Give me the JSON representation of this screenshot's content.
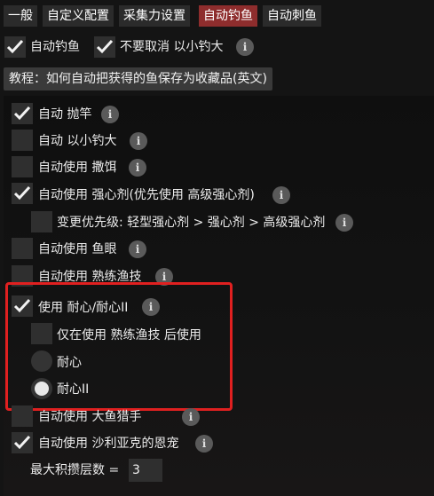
{
  "tabs": [
    {
      "label": "一般",
      "active": false
    },
    {
      "label": "自定义配置",
      "active": false
    },
    {
      "label": "采集力设置",
      "active": false
    },
    {
      "label": "自动钓鱼",
      "active": true
    },
    {
      "label": "自动刺鱼",
      "active": false
    }
  ],
  "top_options": [
    {
      "label": "自动钓鱼",
      "checked": true
    },
    {
      "label": "不要取消 以小钓大",
      "checked": true
    }
  ],
  "tutorial_button": "教程：如何自动把获得的鱼保存为收藏品(英文)",
  "options": [
    {
      "label": "自动 抛竿",
      "checked": true,
      "info": true
    },
    {
      "label": "自动 以小钓大",
      "checked": false,
      "info": true
    },
    {
      "label": "自动使用 撒饵",
      "checked": false,
      "info": true
    },
    {
      "label": "自动使用 强心剂(优先使用 高级强心剂)",
      "checked": true,
      "info": true
    },
    {
      "label": "变更优先级: 轻型强心剂 > 强心剂 > 高级强心剂",
      "checked": false,
      "info": true
    },
    {
      "label": "自动使用 鱼眼",
      "checked": false,
      "info": true
    },
    {
      "label": "自动使用 熟练渔技",
      "checked": false,
      "info": true
    },
    {
      "label": "使用 耐心/耐心II",
      "checked": true,
      "info": true
    },
    {
      "label": "仅在使用 熟练渔技 后使用",
      "checked": false,
      "info": false
    },
    {
      "label": "自动使用 大鱼猎手",
      "checked": false,
      "info": true
    },
    {
      "label": "自动使用 沙利亚克的恩宠",
      "checked": true,
      "info": true
    }
  ],
  "radios": [
    {
      "label": "耐心",
      "selected": false
    },
    {
      "label": "耐心II",
      "selected": true
    }
  ],
  "max_stack": {
    "label": "最大积攒层数 =",
    "value": "3"
  },
  "info_glyph": "i",
  "colors": {
    "active_tab": "#8e2d2d",
    "highlight": "#e02020"
  }
}
